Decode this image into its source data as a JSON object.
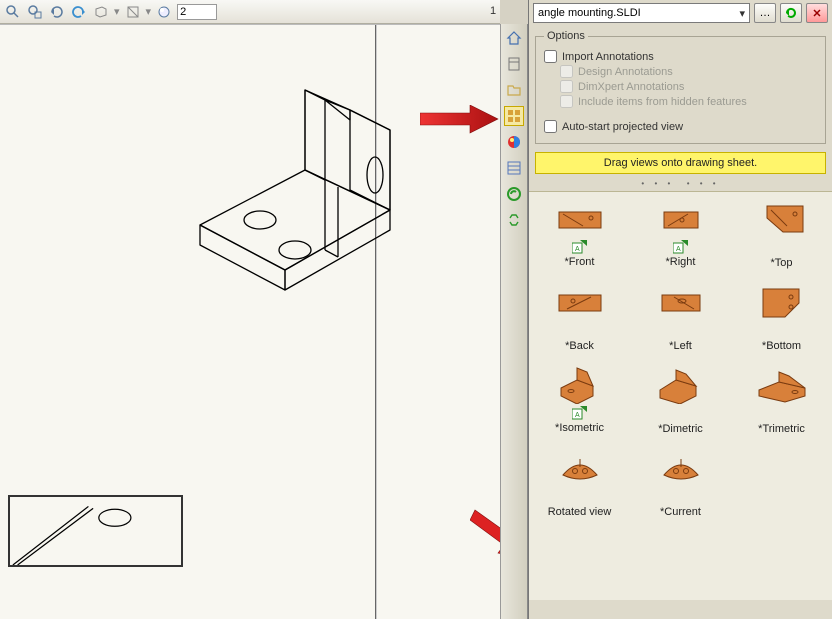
{
  "toolbar": {
    "text_value": "2"
  },
  "filename": "angle mounting.SLDI",
  "options": {
    "group_label": "Options",
    "import_annotations": "Import Annotations",
    "design_annotations": "Design Annotations",
    "dimxpert_annotations": "DimXpert Annotations",
    "include_hidden": "Include items from hidden features",
    "auto_start": "Auto-start projected view"
  },
  "banner": "Drag views onto drawing sheet.",
  "views": [
    {
      "label": "*Front",
      "has_sub": true
    },
    {
      "label": "*Right",
      "has_sub": true
    },
    {
      "label": "*Top",
      "has_sub": false
    },
    {
      "label": "*Back",
      "has_sub": false
    },
    {
      "label": "*Left",
      "has_sub": false
    },
    {
      "label": "*Bottom",
      "has_sub": false
    },
    {
      "label": "*Isometric",
      "has_sub": true
    },
    {
      "label": "*Dimetric",
      "has_sub": false
    },
    {
      "label": "*Trimetric",
      "has_sub": false
    },
    {
      "label": "Rotated view",
      "has_sub": false
    },
    {
      "label": "*Current",
      "has_sub": false
    }
  ]
}
